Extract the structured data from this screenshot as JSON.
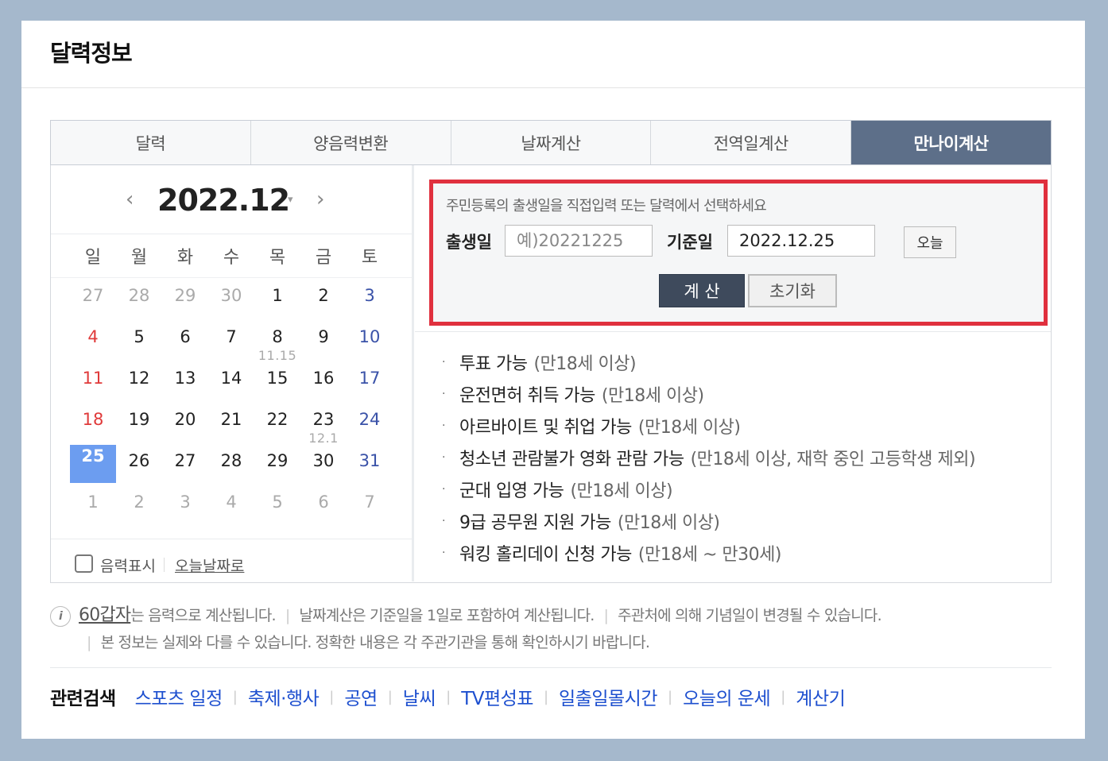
{
  "title": "달력정보",
  "tabs": [
    {
      "label": "달력"
    },
    {
      "label": "양음력변환"
    },
    {
      "label": "날짜계산"
    },
    {
      "label": "전역일계산"
    },
    {
      "label": "만나이계산",
      "active": true
    }
  ],
  "calendar": {
    "month": "2022.12",
    "prev_icon": "‹",
    "next_icon": "›",
    "dropdown_icon": "▾",
    "weekdays": [
      "일",
      "월",
      "화",
      "수",
      "목",
      "금",
      "토"
    ],
    "weeks": [
      [
        {
          "d": "27",
          "t": "muted"
        },
        {
          "d": "28",
          "t": "muted"
        },
        {
          "d": "29",
          "t": "muted"
        },
        {
          "d": "30",
          "t": "muted"
        },
        {
          "d": "1"
        },
        {
          "d": "2"
        },
        {
          "d": "3",
          "t": "sat"
        }
      ],
      [
        {
          "d": "4",
          "t": "sun"
        },
        {
          "d": "5"
        },
        {
          "d": "6"
        },
        {
          "d": "7"
        },
        {
          "d": "8",
          "lunar": "11.15"
        },
        {
          "d": "9"
        },
        {
          "d": "10",
          "t": "sat"
        }
      ],
      [
        {
          "d": "11",
          "t": "sun"
        },
        {
          "d": "12"
        },
        {
          "d": "13"
        },
        {
          "d": "14"
        },
        {
          "d": "15"
        },
        {
          "d": "16"
        },
        {
          "d": "17",
          "t": "sat"
        }
      ],
      [
        {
          "d": "18",
          "t": "sun"
        },
        {
          "d": "19"
        },
        {
          "d": "20"
        },
        {
          "d": "21"
        },
        {
          "d": "22"
        },
        {
          "d": "23",
          "lunar": "12.1"
        },
        {
          "d": "24",
          "t": "sat"
        }
      ],
      [
        {
          "d": "25",
          "t": "today"
        },
        {
          "d": "26"
        },
        {
          "d": "27"
        },
        {
          "d": "28"
        },
        {
          "d": "29"
        },
        {
          "d": "30"
        },
        {
          "d": "31",
          "t": "sat"
        }
      ],
      [
        {
          "d": "1",
          "t": "muted"
        },
        {
          "d": "2",
          "t": "muted"
        },
        {
          "d": "3",
          "t": "muted"
        },
        {
          "d": "4",
          "t": "muted"
        },
        {
          "d": "5",
          "t": "muted"
        },
        {
          "d": "6",
          "t": "muted"
        },
        {
          "d": "7",
          "t": "muted"
        }
      ]
    ],
    "lunar_toggle_label": "음력표시",
    "today_link": "오늘날짜로"
  },
  "calculator": {
    "description": "주민등록의 출생일을 직접입력 또는 달력에서 선택하세요",
    "birth_label": "출생일",
    "birth_value": "",
    "birth_placeholder": "예)20221225",
    "base_label": "기준일",
    "base_value": "2022.12.25",
    "today_button": "오늘",
    "calc_button": "계 산",
    "reset_button": "초기화"
  },
  "results": [
    {
      "text": "투표 가능",
      "note": "(만18세 이상)"
    },
    {
      "text": "운전면허 취득 가능",
      "note": "(만18세 이상)"
    },
    {
      "text": "아르바이트 및 취업 가능",
      "note": "(만18세 이상)"
    },
    {
      "text": "청소년 관람불가 영화 관람 가능",
      "note": "(만18세 이상, 재학 중인 고등학생 제외)"
    },
    {
      "text": "군대 입영 가능",
      "note": "(만18세 이상)"
    },
    {
      "text": "9급 공무원 지원 가능",
      "note": "(만18세 이상)"
    },
    {
      "text": "워킹 홀리데이 신청 가능",
      "note": "(만18세 ~ 만30세)"
    }
  ],
  "info": {
    "icon": "i",
    "ganji_link": "60갑자",
    "ganji_rest": "는 음력으로 계산됩니다.",
    "note2": "날짜계산은 기준일을 1일로 포함하여 계산됩니다.",
    "note3": "주관처에 의해 기념일이 변경될 수 있습니다.",
    "note4": "본 정보는 실제와 다를 수 있습니다. 정확한 내용은 각 주관기관을 통해 확인하시기 바랍니다."
  },
  "related": {
    "title": "관련검색",
    "links": [
      "스포츠 일정",
      "축제·행사",
      "공연",
      "날씨",
      "TV편성표",
      "일출일몰시간",
      "오늘의 운세",
      "계산기"
    ]
  }
}
